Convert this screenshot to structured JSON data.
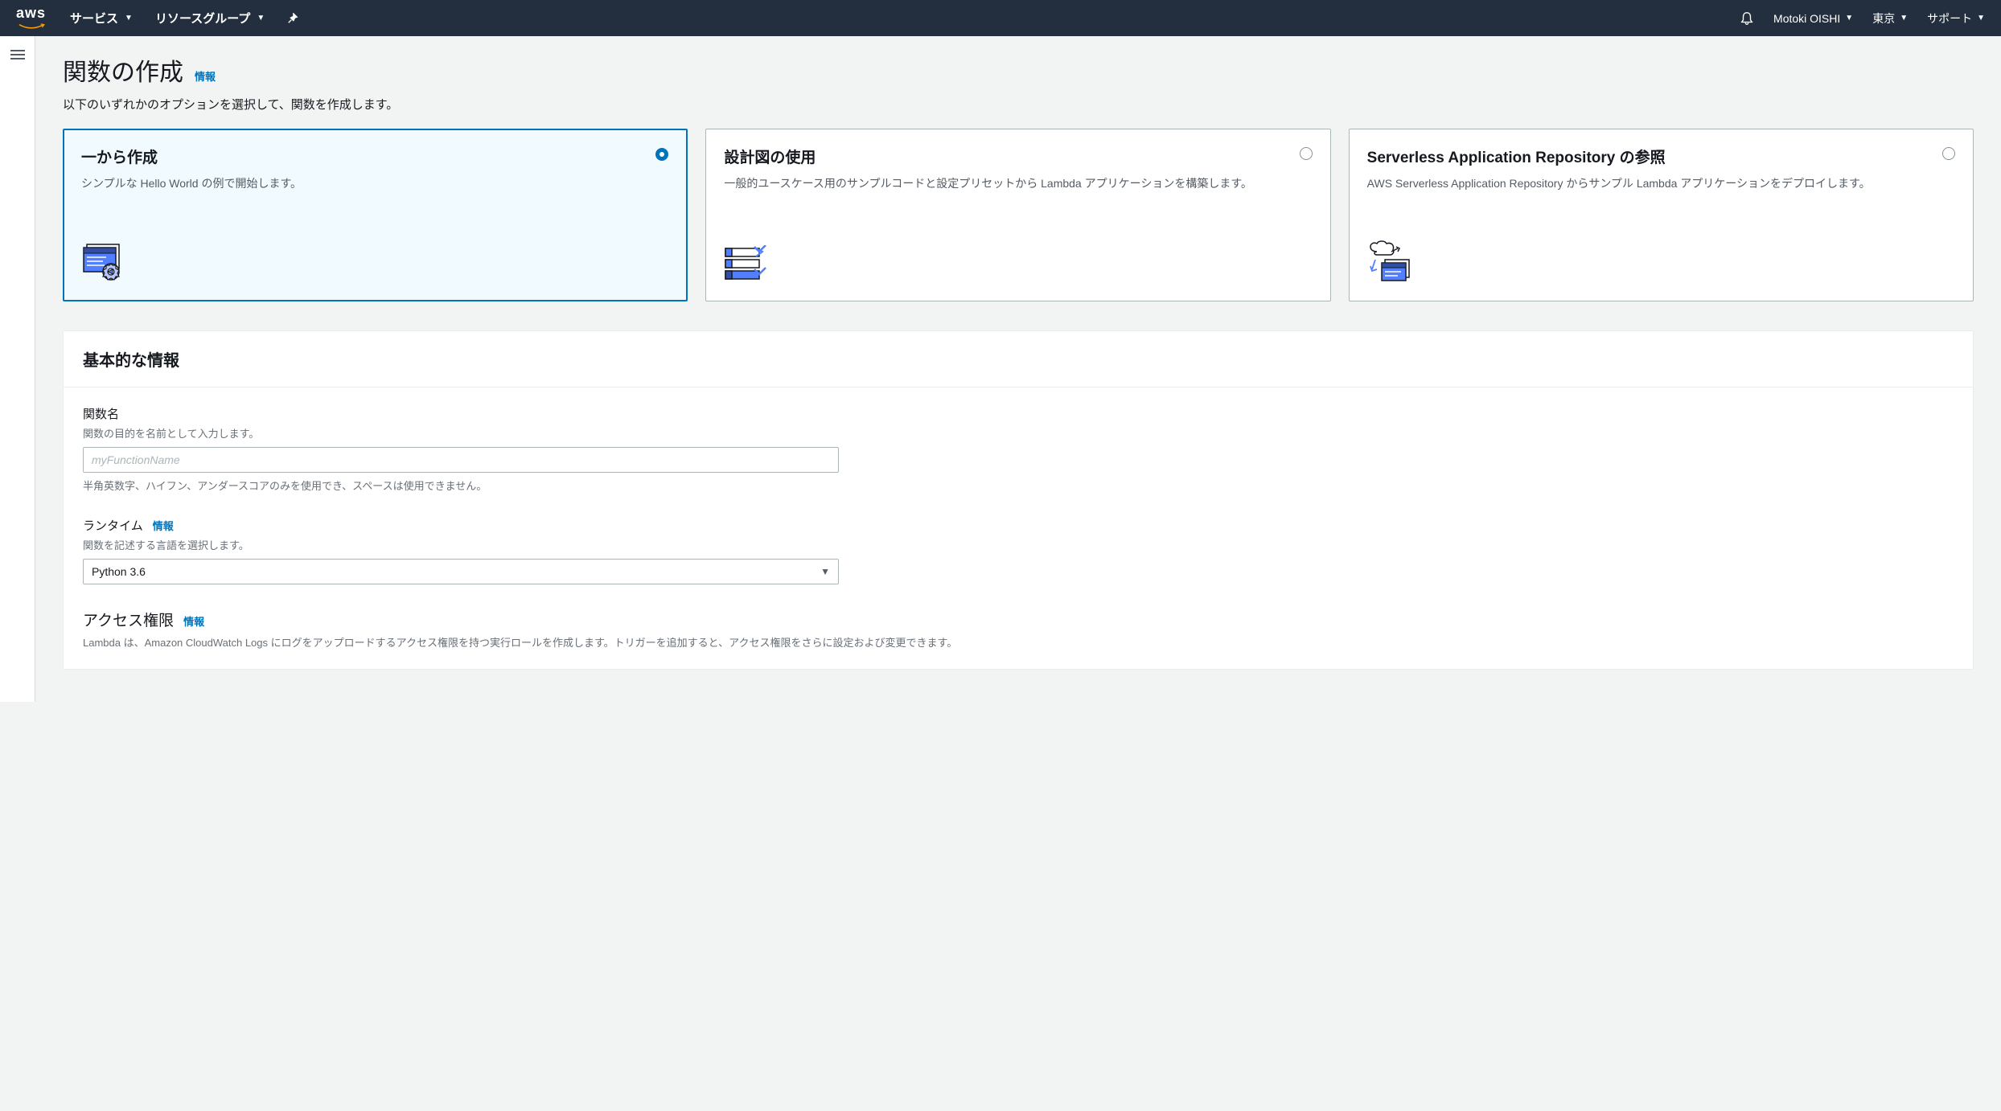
{
  "nav": {
    "services": "サービス",
    "resource_groups": "リソースグループ",
    "user": "Motoki OISHI",
    "region": "東京",
    "support": "サポート"
  },
  "page": {
    "title": "関数の作成",
    "info_label": "情報",
    "subtitle": "以下のいずれかのオプションを選択して、関数を作成します。"
  },
  "options": [
    {
      "title": "一から作成",
      "desc": "シンプルな Hello World の例で開始します。",
      "selected": true
    },
    {
      "title": "設計図の使用",
      "desc": "一般的ユースケース用のサンプルコードと設定プリセットから Lambda アプリケーションを構築します。",
      "selected": false
    },
    {
      "title": "Serverless Application Repository の参照",
      "desc": "AWS Serverless Application Repository からサンプル Lambda アプリケーションをデプロイします。",
      "selected": false
    }
  ],
  "basic_info": {
    "panel_title": "基本的な情報",
    "function_name": {
      "label": "関数名",
      "hint": "関数の目的を名前として入力します。",
      "placeholder": "myFunctionName",
      "value": "",
      "help": "半角英数字、ハイフン、アンダースコアのみを使用でき、スペースは使用できません。"
    },
    "runtime": {
      "label": "ランタイム",
      "info_label": "情報",
      "hint": "関数を記述する言語を選択します。",
      "selected": "Python 3.6"
    },
    "permissions": {
      "label": "アクセス権限",
      "info_label": "情報",
      "desc": "Lambda は、Amazon CloudWatch Logs にログをアップロードするアクセス権限を持つ実行ロールを作成します。トリガーを追加すると、アクセス権限をさらに設定および変更できます。"
    }
  }
}
